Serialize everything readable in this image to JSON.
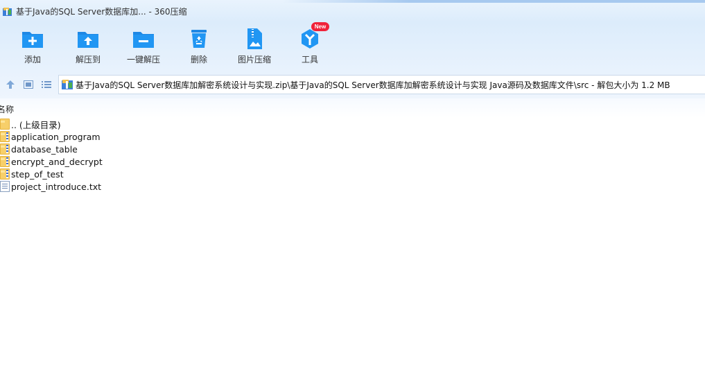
{
  "window": {
    "title": "基于Java的SQL Server数据库加... - 360压缩"
  },
  "toolbar": {
    "items": [
      {
        "label": "添加",
        "icon": "add-folder-icon"
      },
      {
        "label": "解压到",
        "icon": "extract-to-icon"
      },
      {
        "label": "一键解压",
        "icon": "one-click-extract-icon"
      },
      {
        "label": "删除",
        "icon": "recycle-bin-icon"
      },
      {
        "label": "图片压缩",
        "icon": "image-compress-icon"
      },
      {
        "label": "工具",
        "icon": "tools-icon"
      }
    ],
    "new_badge": "New"
  },
  "addressbar": {
    "path": "基于Java的SQL Server数据库加解密系统设计与实现.zip\\基于Java的SQL Server数据库加解密系统设计与实现 Java源码及数据库文件\\src - 解包大小为 1.2 MB"
  },
  "filelist": {
    "column_name": "名称",
    "rows": [
      {
        "name": ".. (上级目录)",
        "type": "folder"
      },
      {
        "name": "application_program",
        "type": "zip-folder"
      },
      {
        "name": "database_table",
        "type": "zip-folder"
      },
      {
        "name": "encrypt_and_decrypt",
        "type": "zip-folder"
      },
      {
        "name": "step_of_test",
        "type": "zip-folder"
      },
      {
        "name": "project_introduce.txt",
        "type": "text-file"
      }
    ]
  },
  "colors": {
    "accent": "#1e88e5",
    "badge": "#f0223a"
  }
}
